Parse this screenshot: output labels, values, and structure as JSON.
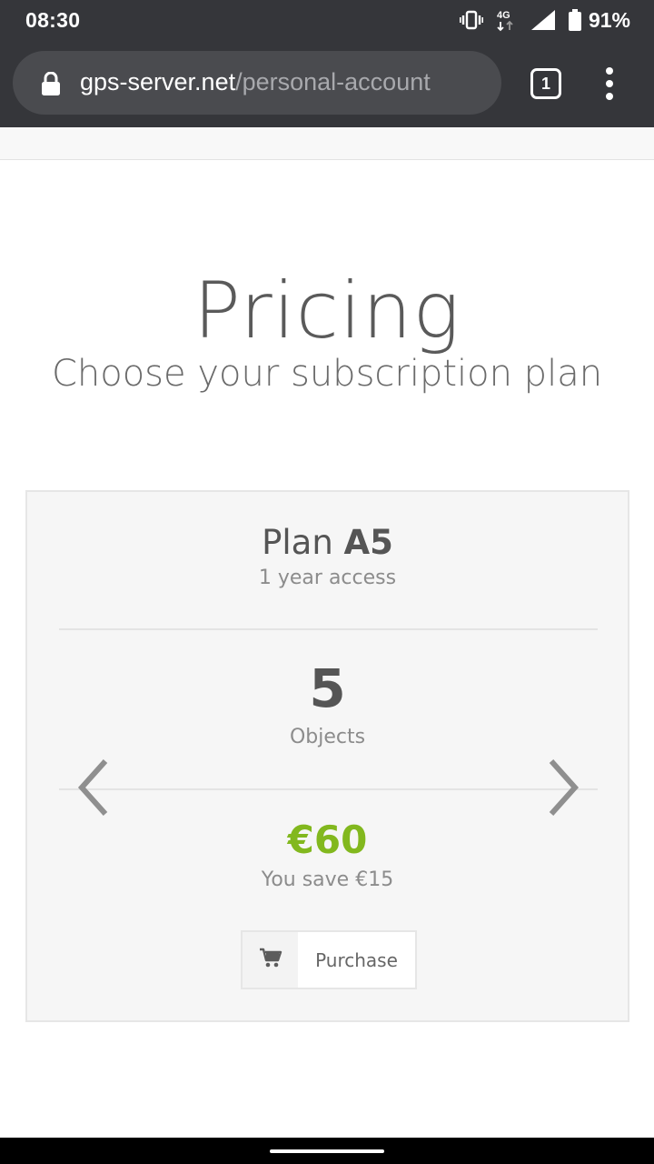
{
  "status_bar": {
    "time": "08:30",
    "network": "4G",
    "battery_percent": "91%",
    "icons": [
      "vibrate-icon",
      "mobile-data-icon",
      "signal-icon",
      "battery-icon"
    ]
  },
  "browser": {
    "url_domain": "gps-server.net",
    "url_path": "/personal-account",
    "tab_count": "1",
    "icons": [
      "lock-icon",
      "menu-icon"
    ]
  },
  "page": {
    "title": "Pricing",
    "subtitle": "Choose your subscription plan"
  },
  "plan": {
    "name_prefix": "Plan ",
    "name_code": "A5",
    "access": "1 year access",
    "objects_count": "5",
    "objects_label": "Objects",
    "price": "€60",
    "savings": "You save €15",
    "purchase_label": "Purchase",
    "icons": [
      "cart-icon",
      "chevron-left-icon",
      "chevron-right-icon"
    ]
  },
  "colors": {
    "price_green": "#82b81e",
    "browser_bar": "#35363a"
  }
}
